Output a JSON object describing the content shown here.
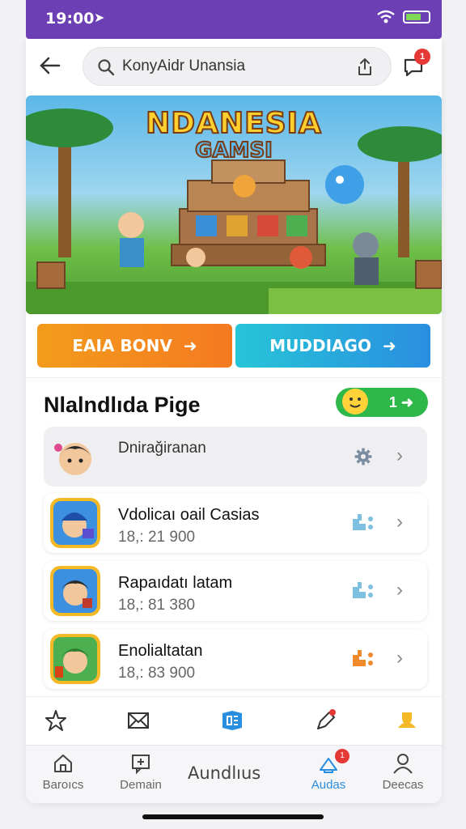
{
  "status": {
    "time": "19:00",
    "signal": "wifi-icon",
    "battery": "battery-icon"
  },
  "header": {
    "back_icon": "arrow-left-icon",
    "search_value": "KonyAidr Unansia",
    "share_icon": "share-icon",
    "notif_icon": "chat-icon",
    "notif_count": "1"
  },
  "banner": {
    "title_line1": "NDANESIA",
    "title_line2": "GAMSI"
  },
  "cta": {
    "left_label": "EAIA BONV",
    "right_label": "MUDDIAGO"
  },
  "section": {
    "title": "Nlalndlıda Pige",
    "badge_label": "1 ➜",
    "items": [
      {
        "title": "Dnirağiranan",
        "subtitle": "",
        "icon": "gear-icon"
      },
      {
        "title": "Vdolicaı oail Casias",
        "subtitle": "18,: 21 900",
        "icon": "grid-icon"
      },
      {
        "title": "Rapaıdatı latam",
        "subtitle": "18,: 81 380",
        "icon": "grid-icon"
      },
      {
        "title": "Enolialtatan",
        "subtitle": "18,: 83 900",
        "icon": "grid-orange-icon"
      }
    ]
  },
  "icon_bar": [
    "star-icon",
    "mail-icon",
    "games-icon",
    "pen-icon",
    "trophy-icon"
  ],
  "tabs": [
    {
      "label": "Baroıcs",
      "icon": "home-icon"
    },
    {
      "label": "Demain",
      "icon": "chat-icon"
    },
    {
      "label": "Aundlıus",
      "icon": ""
    },
    {
      "label": "Audas",
      "icon": "bell-icon",
      "badge": "1"
    },
    {
      "label": "Deecas",
      "icon": "profile-icon"
    }
  ],
  "colors": {
    "brand": "#6c3fb5",
    "accent_orange": "#f47a20",
    "accent_blue": "#2a8ee0",
    "green": "#2fb84a"
  }
}
